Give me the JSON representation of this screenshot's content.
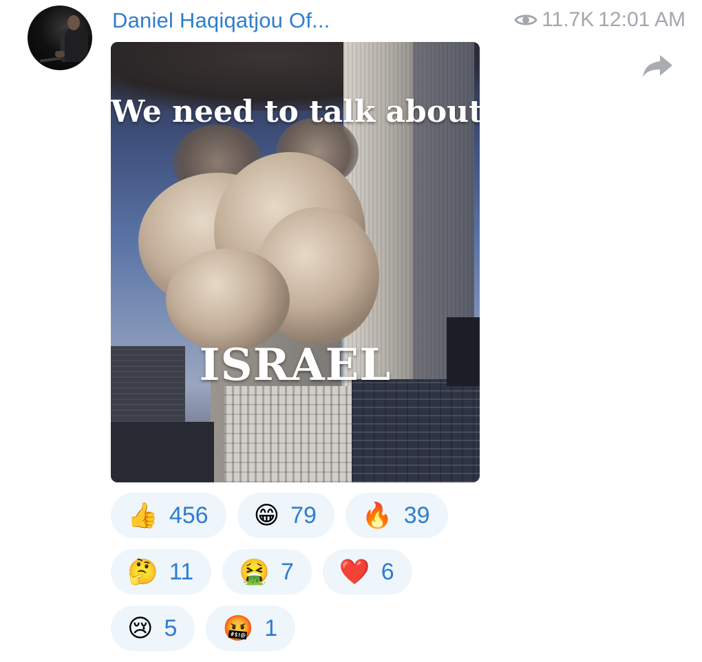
{
  "message": {
    "sender_name": "Daniel Haqiqatjou Of...",
    "views": "11.7K",
    "time": "12:01 AM",
    "image_caption_top": "We need to talk about",
    "image_caption_bottom": "ISRAEL"
  },
  "icons": {
    "views": "eye-icon",
    "forward": "forward-arrow-icon"
  },
  "colors": {
    "link_blue": "#2f7dcd",
    "meta_gray": "#a2a7ad",
    "reaction_bg": "#eef5fb"
  },
  "reactions": [
    [
      {
        "emoji": "👍",
        "count": "456"
      },
      {
        "emoji": "😁",
        "count": "79"
      },
      {
        "emoji": "🔥",
        "count": "39"
      }
    ],
    [
      {
        "emoji": "🤔",
        "count": "11"
      },
      {
        "emoji": "🤮",
        "count": "7"
      },
      {
        "emoji": "❤️",
        "count": "6"
      }
    ],
    [
      {
        "emoji": "😢",
        "count": "5"
      },
      {
        "emoji": "🤬",
        "count": "1"
      }
    ]
  ]
}
